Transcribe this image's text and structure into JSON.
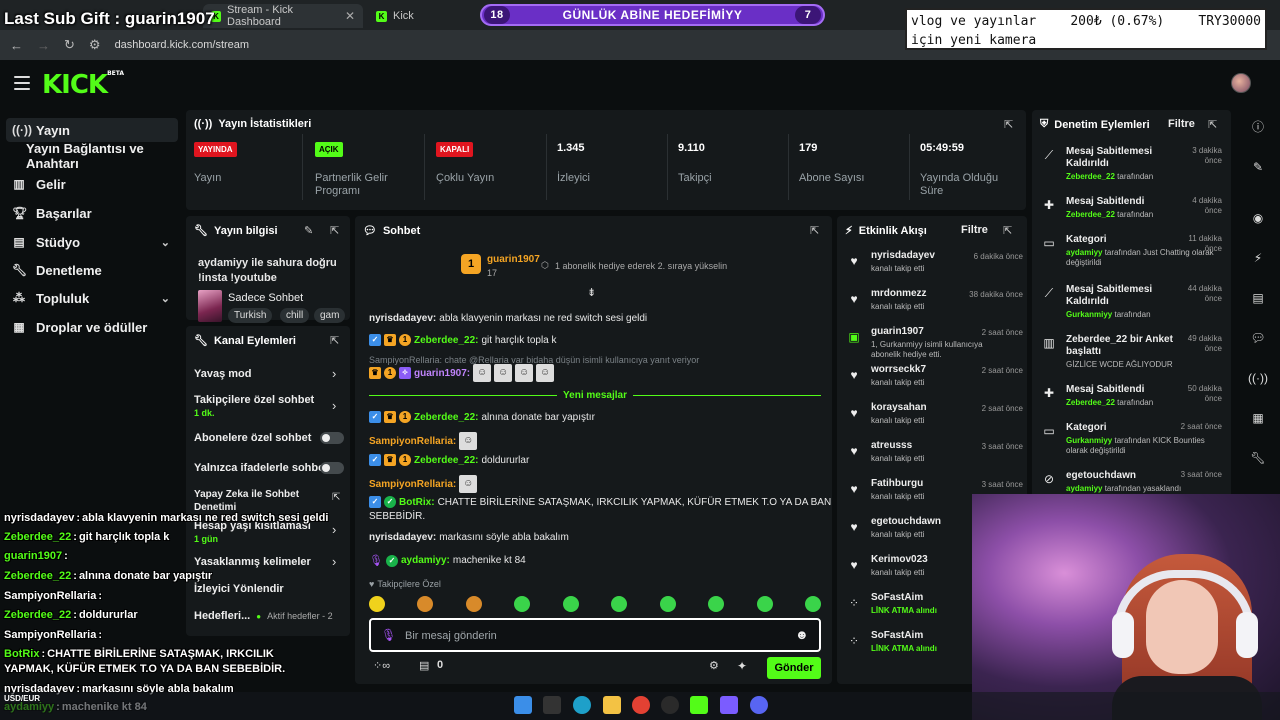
{
  "browser": {
    "tabs": [
      {
        "title": "Stream - Kick Dashboard"
      },
      {
        "title": "Kick"
      }
    ],
    "url": "dashboard.kick.com/stream"
  },
  "overlay": {
    "last_sub_gift": "Last Sub Gift : guarin1907",
    "goal_bar": {
      "left": "18",
      "label": "GÜNLÜK ABİNE HEDEFİMİYY",
      "right": "7"
    },
    "goal_box": {
      "line1": "vlog ve yayınlar",
      "amount": "200₺ (0.67%)",
      "target": "TRY30000",
      "line2": "için yeni kamera"
    },
    "chat": [
      {
        "user": "nyrisdadayev",
        "text": "abla klavyenin markası ne red switch sesi geldi"
      },
      {
        "user": "Zeberdee_22",
        "text": "git harçlık topla k"
      },
      {
        "user": "guarin1907",
        "text": ""
      },
      {
        "user": "Zeberdee_22",
        "text": "alnına donate bar yapıştır"
      },
      {
        "user": "SampiyonRellaria",
        "text": ""
      },
      {
        "user": "Zeberdee_22",
        "text": "doldururlar"
      },
      {
        "user": "SampiyonRellaria",
        "text": ""
      },
      {
        "user": "BotRix",
        "text": "CHATTE BİRİLERİNE SATAŞMAK, IRKCILIK"
      },
      {
        "user": "",
        "text": "YAPMAK, KÜFÜR ETMEK T.O YA DA BAN SEBEBİDİR."
      },
      {
        "user": "nyrisdadayev",
        "text": "markasını söyle abla bakalım"
      },
      {
        "user": "aydamiyy",
        "text": "machenike kt 84"
      }
    ],
    "fx_label": "USD/EUR"
  },
  "sidebar": {
    "items": [
      {
        "label": "Yayın",
        "icon": "broadcast-icon"
      },
      {
        "label": "Yayın Bağlantısı ve Anahtarı"
      },
      {
        "label": "Gelir",
        "icon": "chart-icon"
      },
      {
        "label": "Başarılar",
        "icon": "trophy-icon"
      },
      {
        "label": "Stüdyo",
        "icon": "studio-icon"
      },
      {
        "label": "Denetleme",
        "icon": "wrench-icon"
      },
      {
        "label": "Topluluk",
        "icon": "community-icon"
      },
      {
        "label": "Droplar ve ödüller",
        "icon": "drops-icon"
      }
    ]
  },
  "stats": {
    "title": "Yayın İstatistikleri",
    "items": [
      {
        "value": "YAYINDA",
        "label": "Yayın"
      },
      {
        "value": "AÇIK",
        "label": "Partnerlik Gelir Programı"
      },
      {
        "value": "KAPALI",
        "label": "Çoklu Yayın"
      },
      {
        "value": "1.345",
        "label": "İzleyici"
      },
      {
        "value": "9.110",
        "label": "Takipçi"
      },
      {
        "value": "179",
        "label": "Abone Sayısı"
      },
      {
        "value": "05:49:59",
        "label": "Yayında Olduğu Süre"
      }
    ]
  },
  "stream_info": {
    "title": "Yayın bilgisi",
    "stream_title": "aydamiyy ile sahura doğru !insta !youtube",
    "category": "Sadece Sohbet",
    "tags": [
      "Turkish",
      "chill",
      "gam"
    ]
  },
  "channel_actions": {
    "title": "Kanal Eylemleri",
    "items": [
      {
        "label": "Yavaş mod",
        "sub": ""
      },
      {
        "label": "Takipçilere özel sohbet",
        "sub": "1 dk."
      },
      {
        "label": "Abonelere özel sohbet",
        "sub": ""
      },
      {
        "label": "Yalnızca ifadelerle sohbet",
        "sub": ""
      },
      {
        "label": "Yapay Zeka ile Sohbet Denetimi",
        "sub": ""
      },
      {
        "label": "Hesap yaşı kısıtlaması",
        "sub": "1 gün"
      },
      {
        "label": "Yasaklanmış kelimeler",
        "sub": ""
      },
      {
        "label": "İzleyici Yönlendir",
        "sub": ""
      },
      {
        "label": "Hedefleri...",
        "sub": "Aktif hedefler - 2"
      }
    ]
  },
  "chat": {
    "title": "Sohbet",
    "pinned": {
      "user": "guarin1907",
      "count": "17",
      "text": "1 abonelik hediye ederek 2. sıraya yükselin"
    },
    "messages": [
      {
        "user": "nyrisdadayev:",
        "text": "abla klavyenin markası ne red switch sesi geldi"
      },
      {
        "user": "Zeberdee_22:",
        "text": "git harçlık topla k"
      },
      {
        "reply": "SampiyonRellaria: chate @Rellaria var bidaha düşün isimli kullanıcıya yanıt veriyor"
      },
      {
        "user": "guarin1907:",
        "text": ""
      },
      {
        "user": "Zeberdee_22:",
        "text": "alnına donate bar yapıştır"
      },
      {
        "user": "SampiyonRellaria:",
        "text": ""
      },
      {
        "user": "Zeberdee_22:",
        "text": "doldururlar"
      },
      {
        "user": "SampiyonRellaria:",
        "text": ""
      },
      {
        "user": "BotRix:",
        "text": "CHATTE BİRİLERİNE SATAŞMAK, IRKCILIK YAPMAK, KÜFÜR ETMEK T.O YA DA BAN"
      },
      {
        "user": "",
        "text": "SEBEBİDİR."
      },
      {
        "user": "nyrisdadayev:",
        "text": "markasını söyle abla bakalım"
      },
      {
        "user": "aydamiyy:",
        "text": "machenike kt 84"
      }
    ],
    "new_messages_label": "Yeni mesajlar",
    "followers_only_label": "Takipçilere Özel",
    "input_placeholder": "Bir mesaj gönderin",
    "points": "0",
    "send_label": "Gönder"
  },
  "activity": {
    "title": "Etkinlik Akışı",
    "filter_label": "Filtre",
    "items": [
      {
        "name": "nyrisdadayev",
        "desc": "kanalı takip etti",
        "time": "6 dakika önce",
        "icon": "heart-icon"
      },
      {
        "name": "mrdonmezz",
        "desc": "kanalı takip etti",
        "time": "38 dakika önce",
        "icon": "heart-icon"
      },
      {
        "name": "guarin1907",
        "desc": "1, Gurkanmiyy isimli kullanıcıya abonelik hediye etti.",
        "time": "2 saat önce",
        "icon": "gift-icon"
      },
      {
        "name": "worrseckk7",
        "desc": "kanalı takip etti",
        "time": "2 saat önce",
        "icon": "heart-icon"
      },
      {
        "name": "koraysahan",
        "desc": "kanalı takip etti",
        "time": "2 saat önce",
        "icon": "heart-icon"
      },
      {
        "name": "atreusss",
        "desc": "kanalı takip etti",
        "time": "3 saat önce",
        "icon": "heart-icon"
      },
      {
        "name": "Fatihburgu",
        "desc": "kanalı takip etti",
        "time": "3 saat önce",
        "icon": "heart-icon"
      },
      {
        "name": "egetouchdawn",
        "desc": "kanalı takip etti",
        "time": "3",
        "icon": "heart-icon"
      },
      {
        "name": "Kerimov023",
        "desc": "kanalı takip etti",
        "time": "3",
        "icon": "heart-icon"
      },
      {
        "name": "SoFastAim",
        "desc": "LİNK ATMA alındı",
        "time": "",
        "icon": "points-icon"
      },
      {
        "name": "SoFastAim",
        "desc": "LİNK ATMA alındı",
        "time": "",
        "icon": "points-icon"
      }
    ]
  },
  "moderation": {
    "title": "Denetim Eylemleri",
    "filter_label": "Filtre",
    "items": [
      {
        "title": "Mesaj Sabitlemesi Kaldırıldı",
        "actor": "Zeberdee_22",
        "desc": "tarafından",
        "time": "3 dakika önce",
        "icon": "unpin-icon"
      },
      {
        "title": "Mesaj Sabitlendi",
        "actor": "Zeberdee_22",
        "desc": "tarafından",
        "time": "4 dakika önce",
        "icon": "pin-icon"
      },
      {
        "title": "Kategori",
        "actor": "aydamiyy",
        "desc": "tarafından Just Chatting olarak değiştirildi",
        "time": "11 dakika önce",
        "icon": "category-icon"
      },
      {
        "title": "Mesaj Sabitlemesi Kaldırıldı",
        "actor": "Gurkanmiyy",
        "desc": "tarafından",
        "time": "44 dakika önce",
        "icon": "unpin-icon"
      },
      {
        "title": "Zeberdee_22 bir Anket başlattı",
        "actor": "",
        "desc": "GİZLİCE WCDE AĞLIYODUR",
        "time": "49 dakika önce",
        "icon": "poll-icon"
      },
      {
        "title": "Mesaj Sabitlendi",
        "actor": "Zeberdee_22",
        "desc": "tarafından",
        "time": "50 dakika önce",
        "icon": "pin-icon"
      },
      {
        "title": "Kategori",
        "actor": "Gurkanmiyy",
        "desc": "tarafından KICK Bounties olarak değiştirildi",
        "time": "2 saat önce",
        "icon": "category-icon"
      },
      {
        "title": "egetouchdawn",
        "actor": "aydamiyy",
        "desc": "tarafından yasaklandı",
        "time": "3 saat önce",
        "icon": "ban-icon"
      }
    ]
  }
}
